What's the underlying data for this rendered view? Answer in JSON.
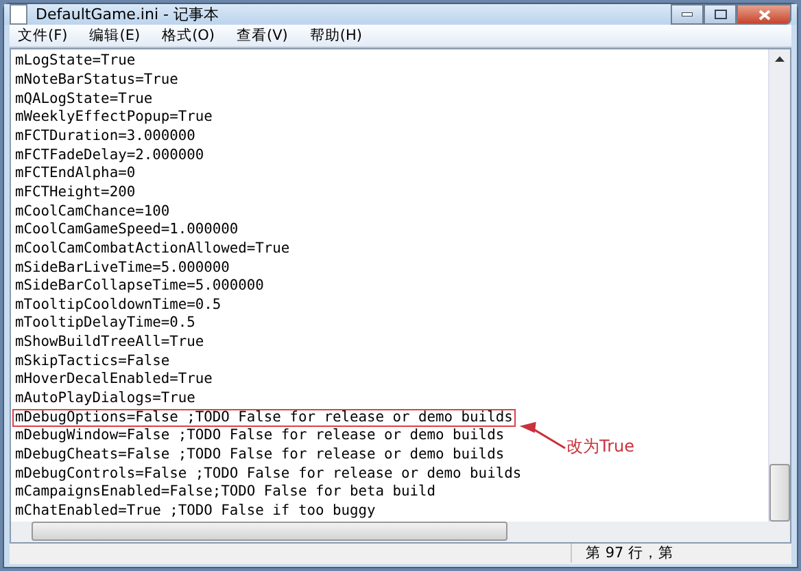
{
  "window": {
    "title": "DefaultGame.ini - 记事本"
  },
  "menu": [
    {
      "label": "文件(F)"
    },
    {
      "label": "编辑(E)"
    },
    {
      "label": "格式(O)"
    },
    {
      "label": "查看(V)"
    },
    {
      "label": "帮助(H)"
    }
  ],
  "lines": [
    {
      "text": "mLogState=True",
      "boxed": false
    },
    {
      "text": "mNoteBarStatus=True",
      "boxed": false
    },
    {
      "text": "mQALogState=True",
      "boxed": false
    },
    {
      "text": "mWeeklyEffectPopup=True",
      "boxed": false
    },
    {
      "text": "mFCTDuration=3.000000",
      "boxed": false
    },
    {
      "text": "mFCTFadeDelay=2.000000",
      "boxed": false
    },
    {
      "text": "mFCTEndAlpha=0",
      "boxed": false
    },
    {
      "text": "mFCTHeight=200",
      "boxed": false
    },
    {
      "text": "mCoolCamChance=100",
      "boxed": false
    },
    {
      "text": "mCoolCamGameSpeed=1.000000",
      "boxed": false
    },
    {
      "text": "mCoolCamCombatActionAllowed=True",
      "boxed": false
    },
    {
      "text": "mSideBarLiveTime=5.000000",
      "boxed": false
    },
    {
      "text": "mSideBarCollapseTime=5.000000",
      "boxed": false
    },
    {
      "text": "mTooltipCooldownTime=0.5",
      "boxed": false
    },
    {
      "text": "mTooltipDelayTime=0.5",
      "boxed": false
    },
    {
      "text": "mShowBuildTreeAll=True",
      "boxed": false
    },
    {
      "text": "mSkipTactics=False",
      "boxed": false
    },
    {
      "text": "mHoverDecalEnabled=True",
      "boxed": false
    },
    {
      "text": "mAutoPlayDialogs=True",
      "boxed": false
    },
    {
      "text": "mDebugOptions=False ;TODO False for release or demo builds",
      "boxed": true
    },
    {
      "text": "mDebugWindow=False ;TODO False for release or demo builds",
      "boxed": false
    },
    {
      "text": "mDebugCheats=False ;TODO False for release or demo builds",
      "boxed": false
    },
    {
      "text": "mDebugControls=False ;TODO False for release or demo builds",
      "boxed": false
    },
    {
      "text": "mCampaignsEnabled=False;TODO False for beta build",
      "boxed": false
    },
    {
      "text": "mChatEnabled=True ;TODO False if too buggy",
      "boxed": false
    }
  ],
  "annotation": {
    "text": "改为True"
  },
  "status_bar": {
    "position": "第 97 行，第"
  }
}
